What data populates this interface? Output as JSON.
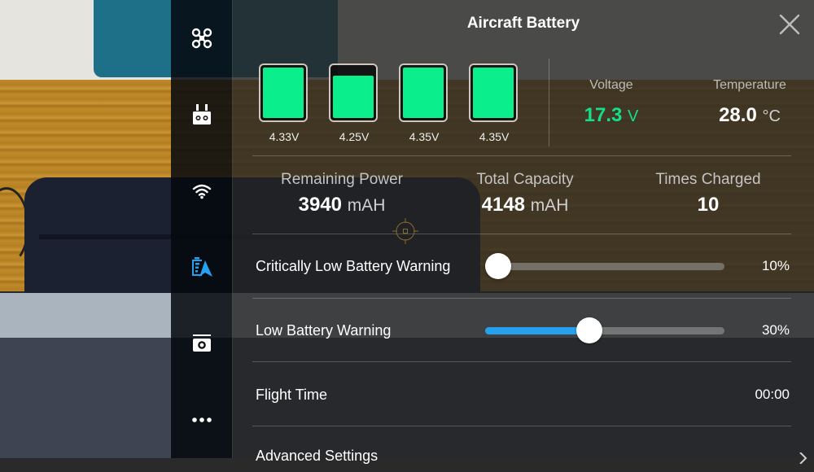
{
  "header": {
    "title": "Aircraft Battery",
    "close_icon": "close-icon"
  },
  "sidebar": {
    "items": [
      {
        "icon": "aircraft-icon",
        "label": "Aircraft",
        "active": false
      },
      {
        "icon": "remote-controller-icon",
        "label": "Remote Controller",
        "active": false
      },
      {
        "icon": "wifi-icon",
        "label": "Transmission",
        "active": false
      },
      {
        "icon": "battery-icon",
        "label": "Aircraft Battery",
        "active": true
      },
      {
        "icon": "camera-icon",
        "label": "Gimbal / Camera",
        "active": false
      },
      {
        "icon": "more-icon",
        "label": "More",
        "active": false
      }
    ]
  },
  "cells": [
    {
      "voltage": "4.33V",
      "level": 1.0
    },
    {
      "voltage": "4.25V",
      "level": 0.85
    },
    {
      "voltage": "4.35V",
      "level": 1.0
    },
    {
      "voltage": "4.35V",
      "level": 1.0
    }
  ],
  "summary": {
    "voltage": {
      "label": "Voltage",
      "value": "17.3",
      "unit": "V"
    },
    "temperature": {
      "label": "Temperature",
      "value": "28.0",
      "unit": "°C"
    }
  },
  "stats": {
    "remaining": {
      "label": "Remaining Power",
      "value": "3940",
      "unit": "mAH"
    },
    "capacity": {
      "label": "Total Capacity",
      "value": "4148",
      "unit": "mAH"
    },
    "charged": {
      "label": "Times Charged",
      "value": "10"
    }
  },
  "settings": {
    "critical": {
      "label": "Critically Low Battery Warning",
      "value": "10%",
      "percent": 10,
      "min": 10,
      "max": 50
    },
    "low": {
      "label": "Low Battery Warning",
      "value": "30%",
      "percent": 30,
      "min": 15,
      "max": 50
    },
    "flight_time": {
      "label": "Flight Time",
      "value": "00:00"
    },
    "advanced": {
      "label": "Advanced Settings"
    }
  },
  "colors": {
    "accent": "#26a1f0",
    "cell_fill": "#0bee8c",
    "voltage_green": "#12e08c"
  }
}
